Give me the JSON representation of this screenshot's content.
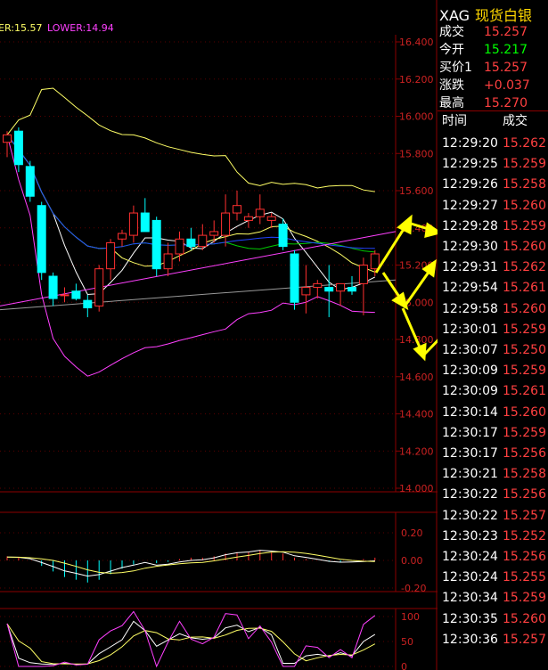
{
  "chart_header": {
    "upper_label": "ER:15.57",
    "lower_label": "LOWER:14.94"
  },
  "price_axis": [
    "16.400",
    "16.200",
    "16.000",
    "15.800",
    "15.600",
    "15.400",
    "15.200",
    "15.000",
    "14.800",
    "14.600",
    "14.400",
    "14.200",
    "14.000"
  ],
  "macd_axis": [
    "0.20",
    "0.00",
    "-0.20"
  ],
  "kdj_axis": [
    "100",
    "50",
    "0"
  ],
  "quote": {
    "symbol": "XAG",
    "name": "现货白银",
    "rows": [
      {
        "label": "成交",
        "value": "15.257",
        "color": "#ff4040"
      },
      {
        "label": "今开",
        "value": "15.217",
        "color": "#00ff00"
      },
      {
        "label": "买价1",
        "value": "15.257",
        "color": "#ff4040"
      },
      {
        "label": "涨跌",
        "value": "+0.037",
        "color": "#ff4040"
      },
      {
        "label": "最高",
        "value": "15.270",
        "color": "#ff4040"
      }
    ]
  },
  "ticks_header": {
    "time": "时间",
    "price": "成交"
  },
  "ticks": [
    {
      "time": "12:29:20",
      "price": "15.262"
    },
    {
      "time": "12:29:25",
      "price": "15.259"
    },
    {
      "time": "12:29:26",
      "price": "15.258"
    },
    {
      "time": "12:29:27",
      "price": "15.260"
    },
    {
      "time": "12:29:28",
      "price": "15.259"
    },
    {
      "time": "12:29:30",
      "price": "15.260"
    },
    {
      "time": "12:29:31",
      "price": "15.262"
    },
    {
      "time": "12:29:54",
      "price": "15.261"
    },
    {
      "time": "12:29:58",
      "price": "15.260"
    },
    {
      "time": "12:30:01",
      "price": "15.259"
    },
    {
      "time": "12:30:07",
      "price": "15.250"
    },
    {
      "time": "12:30:09",
      "price": "15.259"
    },
    {
      "time": "12:30:09",
      "price": "15.261"
    },
    {
      "time": "12:30:14",
      "price": "15.260"
    },
    {
      "time": "12:30:17",
      "price": "15.259"
    },
    {
      "time": "12:30:17",
      "price": "15.256"
    },
    {
      "time": "12:30:21",
      "price": "15.258"
    },
    {
      "time": "12:30:22",
      "price": "15.256"
    },
    {
      "time": "12:30:22",
      "price": "15.257"
    },
    {
      "time": "12:30:23",
      "price": "15.252"
    },
    {
      "time": "12:30:24",
      "price": "15.256"
    },
    {
      "time": "12:30:24",
      "price": "15.255"
    },
    {
      "time": "12:30:34",
      "price": "15.259"
    },
    {
      "time": "12:30:35",
      "price": "15.260"
    },
    {
      "time": "12:30:36",
      "price": "15.257"
    }
  ],
  "chart_data": {
    "type": "candlestick",
    "y_range": [
      14.0,
      16.45
    ],
    "candles": [
      {
        "o": 15.86,
        "h": 15.92,
        "l": 15.78,
        "c": 15.9
      },
      {
        "o": 15.92,
        "h": 15.94,
        "l": 15.7,
        "c": 15.74
      },
      {
        "o": 15.73,
        "h": 15.76,
        "l": 15.54,
        "c": 15.57
      },
      {
        "o": 15.52,
        "h": 15.54,
        "l": 15.12,
        "c": 15.16
      },
      {
        "o": 15.14,
        "h": 15.16,
        "l": 14.98,
        "c": 15.02
      },
      {
        "o": 15.04,
        "h": 15.08,
        "l": 15.0,
        "c": 15.04
      },
      {
        "o": 15.06,
        "h": 15.1,
        "l": 15.01,
        "c": 15.02
      },
      {
        "o": 15.01,
        "h": 15.04,
        "l": 14.92,
        "c": 14.97
      },
      {
        "o": 14.98,
        "h": 15.2,
        "l": 14.95,
        "c": 15.18
      },
      {
        "o": 15.18,
        "h": 15.34,
        "l": 15.12,
        "c": 15.32
      },
      {
        "o": 15.34,
        "h": 15.39,
        "l": 15.3,
        "c": 15.37
      },
      {
        "o": 15.36,
        "h": 15.52,
        "l": 15.32,
        "c": 15.48
      },
      {
        "o": 15.48,
        "h": 15.56,
        "l": 15.38,
        "c": 15.38
      },
      {
        "o": 15.44,
        "h": 15.46,
        "l": 15.14,
        "c": 15.18
      },
      {
        "o": 15.18,
        "h": 15.32,
        "l": 15.14,
        "c": 15.26
      },
      {
        "o": 15.26,
        "h": 15.38,
        "l": 15.22,
        "c": 15.34
      },
      {
        "o": 15.34,
        "h": 15.4,
        "l": 15.28,
        "c": 15.3
      },
      {
        "o": 15.3,
        "h": 15.42,
        "l": 15.28,
        "c": 15.36
      },
      {
        "o": 15.36,
        "h": 15.44,
        "l": 15.32,
        "c": 15.38
      },
      {
        "o": 15.36,
        "h": 15.58,
        "l": 15.3,
        "c": 15.48
      },
      {
        "o": 15.48,
        "h": 15.6,
        "l": 15.44,
        "c": 15.52
      },
      {
        "o": 15.44,
        "h": 15.48,
        "l": 15.4,
        "c": 15.46
      },
      {
        "o": 15.46,
        "h": 15.58,
        "l": 15.42,
        "c": 15.5
      },
      {
        "o": 15.44,
        "h": 15.48,
        "l": 15.4,
        "c": 15.46
      },
      {
        "o": 15.42,
        "h": 15.45,
        "l": 15.28,
        "c": 15.3
      },
      {
        "o": 15.26,
        "h": 15.28,
        "l": 14.96,
        "c": 15.0
      },
      {
        "o": 15.04,
        "h": 15.2,
        "l": 14.94,
        "c": 15.08
      },
      {
        "o": 15.08,
        "h": 15.12,
        "l": 15.02,
        "c": 15.1
      },
      {
        "o": 15.08,
        "h": 15.2,
        "l": 14.92,
        "c": 15.06
      },
      {
        "o": 15.06,
        "h": 15.1,
        "l": 14.98,
        "c": 15.1
      },
      {
        "o": 15.08,
        "h": 15.14,
        "l": 15.04,
        "c": 15.06
      },
      {
        "o": 15.1,
        "h": 15.24,
        "l": 14.93,
        "c": 15.2
      },
      {
        "o": 15.18,
        "h": 15.28,
        "l": 15.14,
        "c": 15.26
      }
    ],
    "macd_hist": [
      0.03,
      0.02,
      0.0,
      -0.04,
      -0.08,
      -0.12,
      -0.14,
      -0.16,
      -0.14,
      -0.1,
      -0.06,
      -0.03,
      0.0,
      -0.02,
      -0.01,
      0.01,
      0.02,
      0.02,
      0.03,
      0.05,
      0.06,
      0.06,
      0.07,
      0.06,
      0.05,
      0.02,
      0.01,
      0.0,
      -0.01,
      -0.01,
      0.0,
      0.01,
      0.02
    ],
    "annotations": "yellow hand-drawn arrows overlaying the chart, pointing toward the tick price list"
  }
}
